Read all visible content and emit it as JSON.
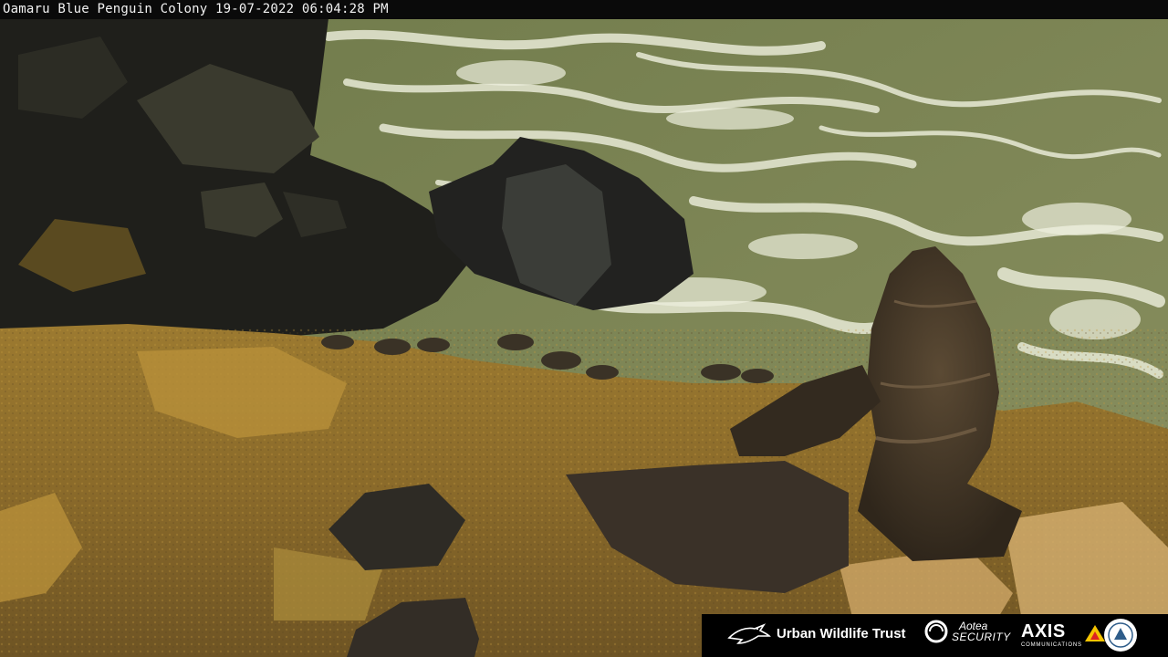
{
  "overlay": {
    "camera_label": "Oamaru Blue Penguin Colony 19-07-2022 06:04:28 PM"
  },
  "sponsors": {
    "urban_wildlife_trust": "Urban Wildlife Trust",
    "aotea_line1": "Aotea",
    "aotea_line2": "SECURITY",
    "axis_line1": "AXIS",
    "axis_line2": "COMMUNICATIONS"
  },
  "colors": {
    "sea": "#7c8652",
    "foam": "#e6e8d4",
    "rock_dark": "#1e1e1a",
    "sand": "#a78333",
    "seal": "#4a3c2a",
    "axis_triangle": "#f5c400"
  }
}
